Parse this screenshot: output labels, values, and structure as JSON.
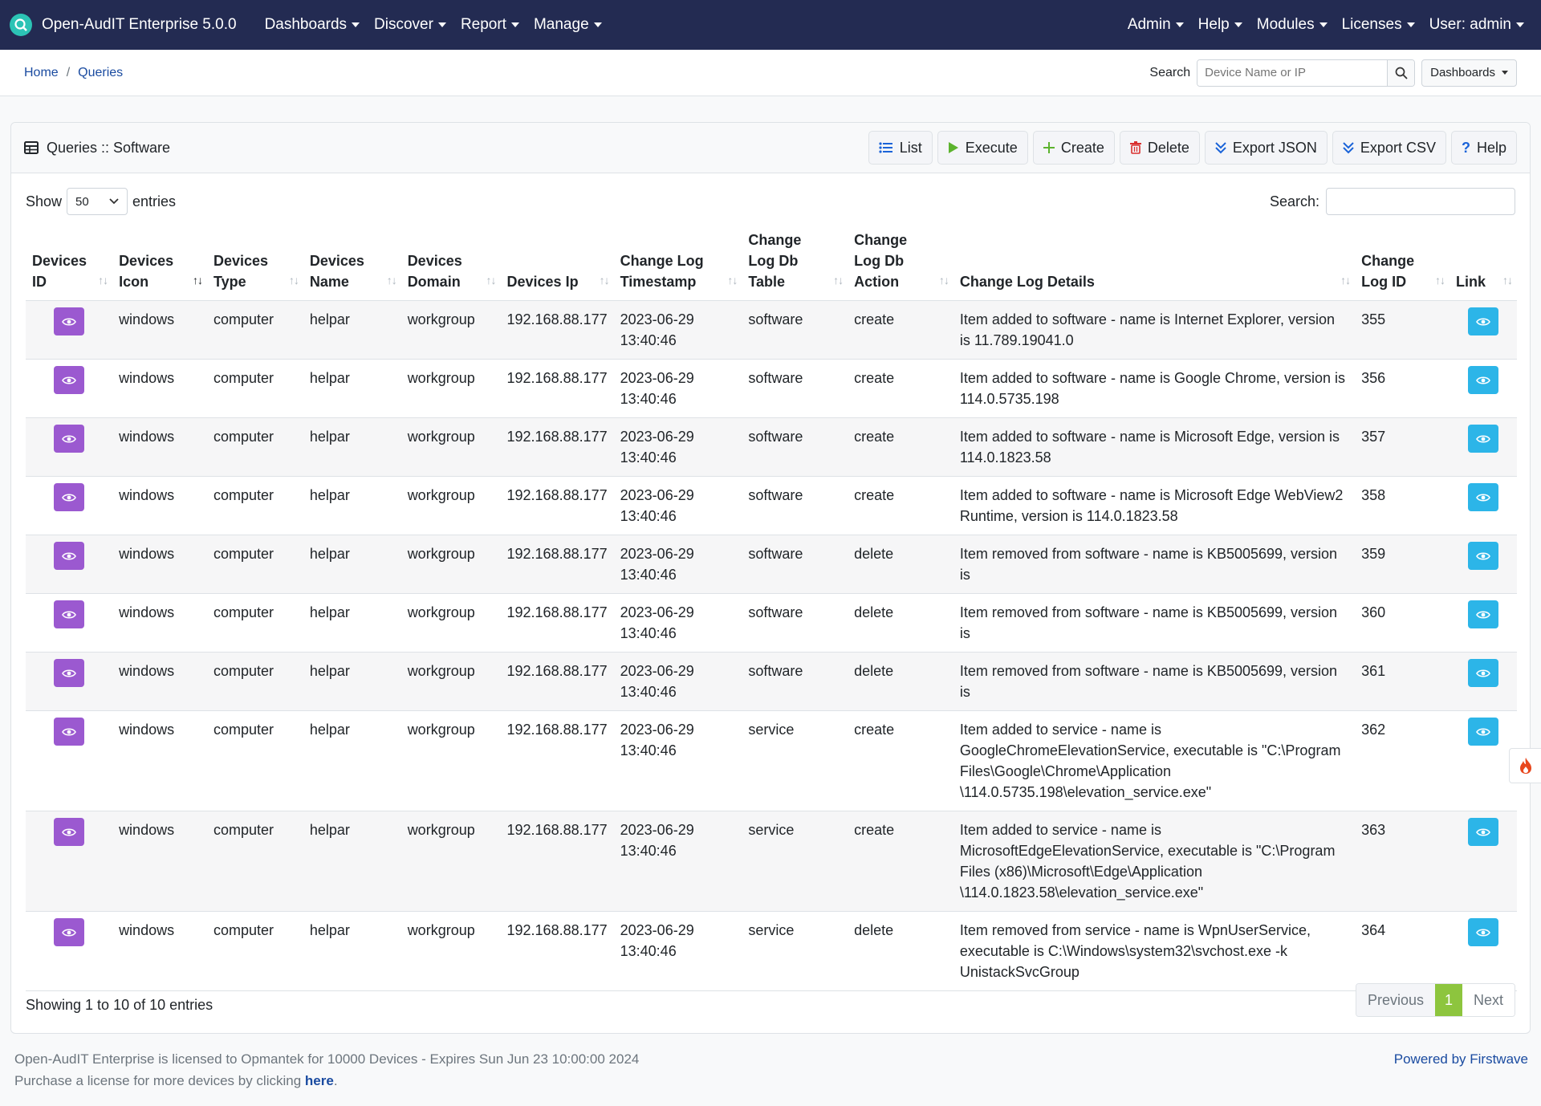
{
  "navbar": {
    "brand": "Open-AudIT Enterprise 5.0.0",
    "left_menus": [
      "Dashboards",
      "Discover",
      "Report",
      "Manage"
    ],
    "right_menus": [
      "Admin",
      "Help",
      "Modules",
      "Licenses",
      "User: admin"
    ]
  },
  "breadcrumb": {
    "home": "Home",
    "current": "Queries"
  },
  "search": {
    "label": "Search",
    "placeholder": "Device Name or IP",
    "dashboards": "Dashboards"
  },
  "card": {
    "title": "Queries :: Software",
    "buttons": [
      "List",
      "Execute",
      "Create",
      "Delete",
      "Export JSON",
      "Export CSV",
      "Help"
    ]
  },
  "controls": {
    "show": "Show",
    "entries_value": "50",
    "entries": "entries",
    "search_label": "Search:"
  },
  "table": {
    "headers": [
      "Devices ID",
      "Devices Icon",
      "Devices Type",
      "Devices Name",
      "Devices Domain",
      "Devices Ip",
      "Change Log Timestamp",
      "Change Log Db Table",
      "Change Log Db Action",
      "Change Log Details",
      "Change Log ID",
      "Link"
    ],
    "rows": [
      {
        "icon": "windows",
        "type": "computer",
        "name": "helpar",
        "domain": "workgroup",
        "ip": "192.168.88.177",
        "timestamp": "2023-06-29 13:40:46",
        "table": "software",
        "action": "create",
        "details": "Item added to software - name is Internet Explorer, version is 11.789.19041.0",
        "id": "355"
      },
      {
        "icon": "windows",
        "type": "computer",
        "name": "helpar",
        "domain": "workgroup",
        "ip": "192.168.88.177",
        "timestamp": "2023-06-29 13:40:46",
        "table": "software",
        "action": "create",
        "details": "Item added to software - name is Google Chrome, version is 114.0.5735.198",
        "id": "356"
      },
      {
        "icon": "windows",
        "type": "computer",
        "name": "helpar",
        "domain": "workgroup",
        "ip": "192.168.88.177",
        "timestamp": "2023-06-29 13:40:46",
        "table": "software",
        "action": "create",
        "details": "Item added to software - name is Microsoft Edge, version is 114.0.1823.58",
        "id": "357"
      },
      {
        "icon": "windows",
        "type": "computer",
        "name": "helpar",
        "domain": "workgroup",
        "ip": "192.168.88.177",
        "timestamp": "2023-06-29 13:40:46",
        "table": "software",
        "action": "create",
        "details": "Item added to software - name is Microsoft Edge WebView2 Runtime, version is 114.0.1823.58",
        "id": "358"
      },
      {
        "icon": "windows",
        "type": "computer",
        "name": "helpar",
        "domain": "workgroup",
        "ip": "192.168.88.177",
        "timestamp": "2023-06-29 13:40:46",
        "table": "software",
        "action": "delete",
        "details": "Item removed from software - name is KB5005699, version is",
        "id": "359"
      },
      {
        "icon": "windows",
        "type": "computer",
        "name": "helpar",
        "domain": "workgroup",
        "ip": "192.168.88.177",
        "timestamp": "2023-06-29 13:40:46",
        "table": "software",
        "action": "delete",
        "details": "Item removed from software - name is KB5005699, version is",
        "id": "360"
      },
      {
        "icon": "windows",
        "type": "computer",
        "name": "helpar",
        "domain": "workgroup",
        "ip": "192.168.88.177",
        "timestamp": "2023-06-29 13:40:46",
        "table": "software",
        "action": "delete",
        "details": "Item removed from software - name is KB5005699, version is",
        "id": "361"
      },
      {
        "icon": "windows",
        "type": "computer",
        "name": "helpar",
        "domain": "workgroup",
        "ip": "192.168.88.177",
        "timestamp": "2023-06-29 13:40:46",
        "table": "service",
        "action": "create",
        "details": "Item added to service - name is GoogleChromeElevationService, executable is \"C:\\Program Files\\Google\\Chrome\\Application \\114.0.5735.198\\elevation_service.exe\"",
        "id": "362"
      },
      {
        "icon": "windows",
        "type": "computer",
        "name": "helpar",
        "domain": "workgroup",
        "ip": "192.168.88.177",
        "timestamp": "2023-06-29 13:40:46",
        "table": "service",
        "action": "create",
        "details": "Item added to service - name is MicrosoftEdgeElevationService, executable is \"C:\\Program Files (x86)\\Microsoft\\Edge\\Application \\114.0.1823.58\\elevation_service.exe\"",
        "id": "363"
      },
      {
        "icon": "windows",
        "type": "computer",
        "name": "helpar",
        "domain": "workgroup",
        "ip": "192.168.88.177",
        "timestamp": "2023-06-29 13:40:46",
        "table": "service",
        "action": "delete",
        "details": "Item removed from service - name is WpnUserService, executable is C:\\Windows\\system32\\svchost.exe -k UnistackSvcGroup",
        "id": "364"
      }
    ]
  },
  "table_footer": {
    "info": "Showing 1 to 10 of 10 entries",
    "previous": "Previous",
    "page": "1",
    "next": "Next"
  },
  "page_footer": {
    "license": "Open-AudIT Enterprise is licensed to Opmantek for 10000 Devices - Expires Sun Jun 23 10:00:00 2024",
    "purchase_prefix": "Purchase a license for more devices by clicking ",
    "purchase_link": "here",
    "purchase_suffix": ".",
    "powered": "Powered by Firstwave"
  },
  "colors": {
    "navbar": "#232b52",
    "view_purple": "#9b59d0",
    "view_blue": "#2cb5e8",
    "page_active": "#8dc53e",
    "link": "#1a4ba0"
  },
  "icons": [
    "logo-icon",
    "search-icon",
    "table-icon",
    "list-icon",
    "play-icon",
    "plus-icon",
    "trash-icon",
    "download-icon",
    "help-icon",
    "eye-icon",
    "flame-icon"
  ]
}
